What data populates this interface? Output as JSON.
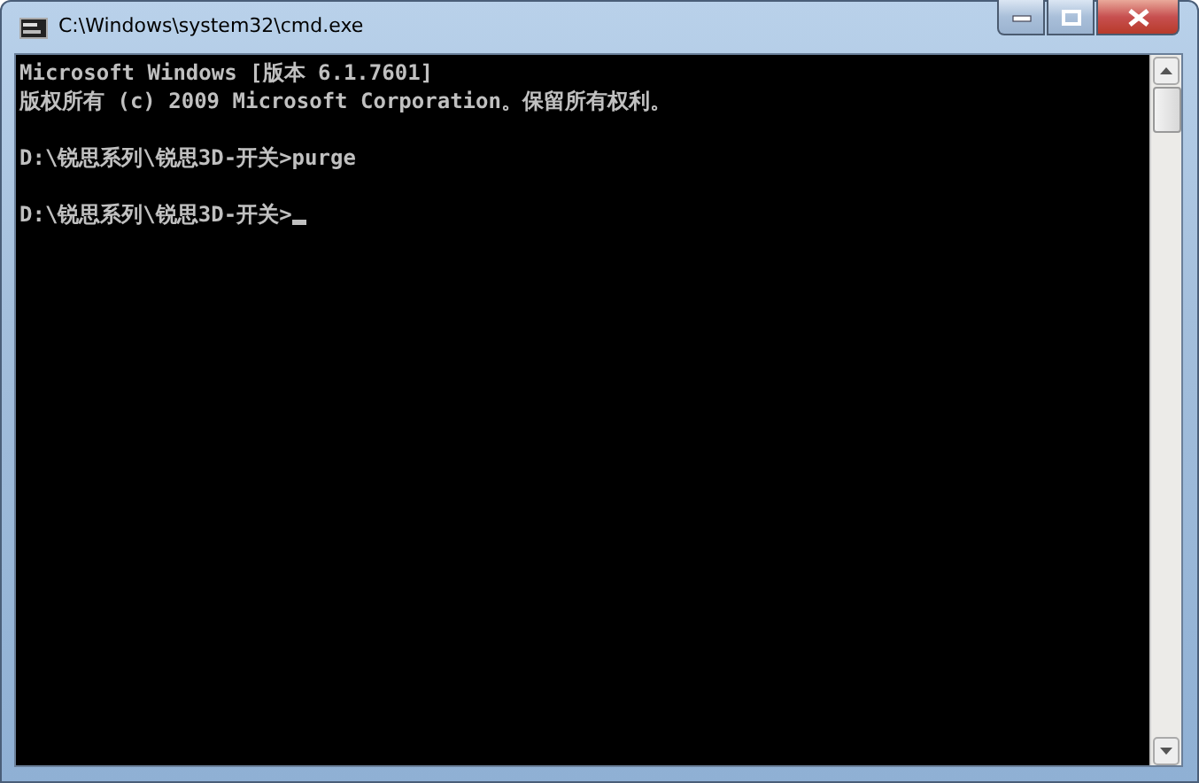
{
  "window": {
    "title": "C:\\Windows\\system32\\cmd.exe"
  },
  "console": {
    "cursor": true,
    "blocks": [
      {
        "lines": [
          "Microsoft Windows [版本 6.1.7601]",
          "版权所有 (c) 2009 Microsoft Corporation。保留所有权利。"
        ]
      },
      {
        "lines": [
          "D:\\锐思系列\\锐思3D-开关>purge"
        ]
      },
      {
        "lines": [
          "D:\\锐思系列\\锐思3D-开关>"
        ]
      }
    ]
  }
}
